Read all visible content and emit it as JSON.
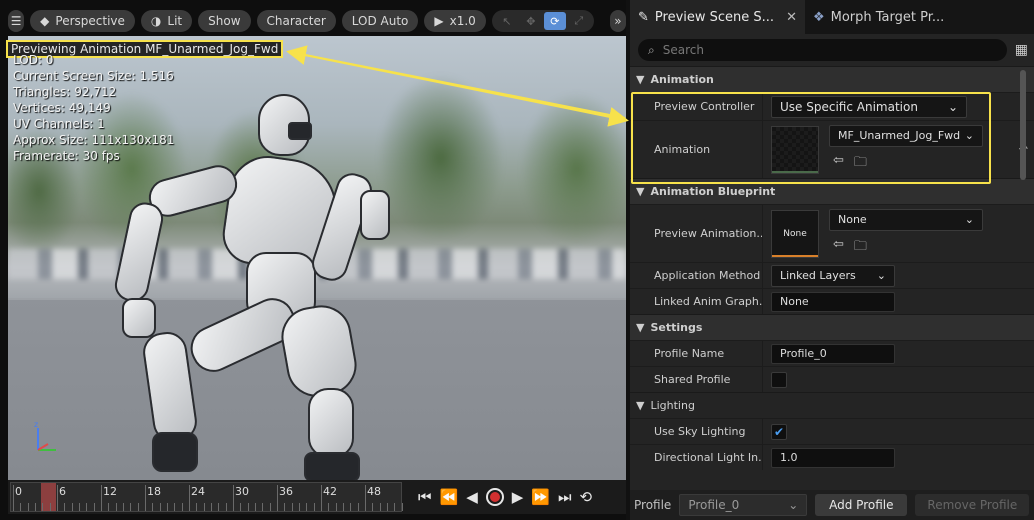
{
  "toolbar": {
    "perspective": "Perspective",
    "lit": "Lit",
    "show": "Show",
    "character": "Character",
    "lod": "LOD Auto",
    "speed": "x1.0"
  },
  "stats": {
    "preview": "Previewing Animation MF_Unarmed_Jog_Fwd",
    "lod": "LOD: 0",
    "screen_size": "Current Screen Size: 1.516",
    "triangles": "Triangles: 92,712",
    "vertices": "Vertices: 49,149",
    "uv": "UV Channels: 1",
    "approx": "Approx Size: 111x130x181",
    "framerate": "Framerate: 30 fps"
  },
  "timeline": {
    "ticks": [
      "0",
      "6",
      "12",
      "18",
      "24",
      "30",
      "36",
      "42",
      "48"
    ]
  },
  "tabs": {
    "preview_scene": "Preview Scene S...",
    "morph_target": "Morph Target Pr..."
  },
  "search": {
    "placeholder": "Search"
  },
  "animation": {
    "category": "Animation",
    "preview_controller_label": "Preview Controller",
    "preview_controller_value": "Use Specific Animation",
    "animation_label": "Animation",
    "animation_value": "MF_Unarmed_Jog_Fwd"
  },
  "anim_bp": {
    "category": "Animation Blueprint",
    "preview_label": "Preview Animation...",
    "thumb_text": "None",
    "preview_value": "None",
    "app_method_label": "Application Method",
    "app_method_value": "Linked Layers",
    "linked_label": "Linked Anim Graph...",
    "linked_value": "None"
  },
  "settings": {
    "category": "Settings",
    "profile_name_label": "Profile Name",
    "profile_name_value": "Profile_0",
    "shared_label": "Shared Profile",
    "lighting_category": "Lighting",
    "sky_label": "Use Sky Lighting",
    "dir_light_label": "Directional Light In...",
    "dir_light_value": "1.0"
  },
  "footer": {
    "profile_label": "Profile",
    "profile_value": "Profile_0",
    "add_profile": "Add Profile",
    "remove_profile": "Remove Profile"
  },
  "colors": {
    "highlight": "#f7e24b",
    "accent": "#5b8fd6",
    "scrub": "#8c3f3f"
  }
}
